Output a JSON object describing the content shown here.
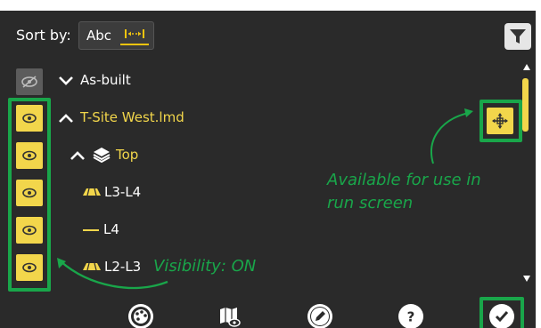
{
  "header": {
    "sort_label": "Sort by:",
    "sort_abc": "Abc",
    "filter_icon": "filter-icon"
  },
  "tree": {
    "visibility_toggle_icon": "eye-slash-icon",
    "items": [
      {
        "label": "As-built",
        "expanded": true
      },
      {
        "label": "T-Site West.lmd",
        "expanded": false
      },
      {
        "label": "Top",
        "expanded": false
      },
      {
        "label": "L3-L4"
      },
      {
        "label": "L4"
      },
      {
        "label": "L2-L3"
      }
    ]
  },
  "annotations": {
    "available": "Available for use in",
    "available_line2": "run screen",
    "visibility": "Visibility: ON"
  },
  "toolbar": {
    "icons": [
      "palette-icon",
      "map-eye-icon",
      "pencil-icon",
      "help-icon",
      "check-icon"
    ]
  },
  "colors": {
    "accent": "#f2d64b",
    "annotation": "#19a64a",
    "background": "#2a2a2a"
  }
}
